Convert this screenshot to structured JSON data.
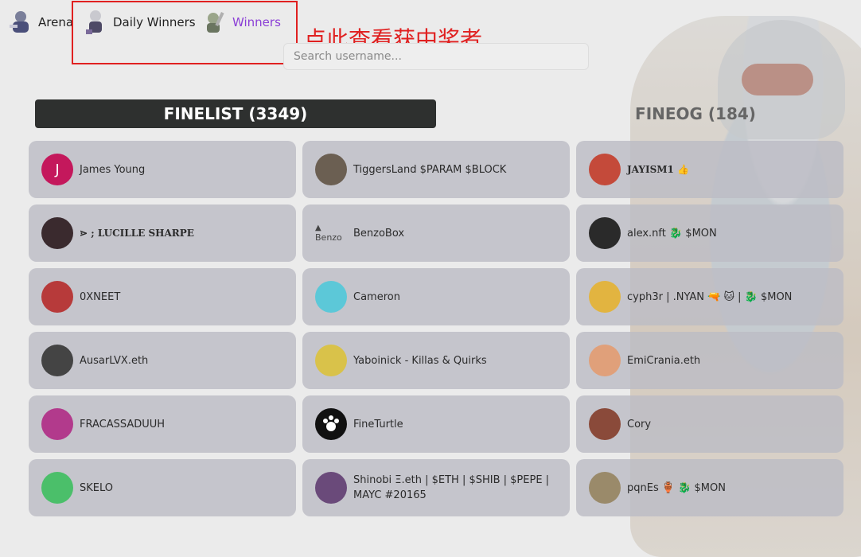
{
  "nav": {
    "arena": "Arena",
    "daily_winners": "Daily Winners",
    "winners": "Winners"
  },
  "annotation": "点此查看获中奖者",
  "search": {
    "placeholder": "Search username..."
  },
  "tabs": {
    "finelist": "FINELIST (3349)",
    "fineog": "FINEOG (184)"
  },
  "colors": {
    "active_tab": "#2e302f",
    "winners_link": "#8b3fd6",
    "annotation": "#e02020"
  },
  "finelist_col1": [
    {
      "name": "James Young",
      "avatar_letter": "J",
      "avatar_color": "#c4185c"
    },
    {
      "name": "⋗ ; LUCILLE SHARPE",
      "avatar_color": "#3a2a2e"
    },
    {
      "name": "0XNEET",
      "avatar_color": "#b73a3a"
    },
    {
      "name": "AusarLVX.eth",
      "avatar_color": "#444444"
    },
    {
      "name": "FRACASSADUUH",
      "avatar_color": "#b23a8c"
    },
    {
      "name": "SKELO",
      "avatar_color": "#4bbf6a"
    }
  ],
  "finelist_col2": [
    {
      "name": "TiggersLand $PARAM $BLOCK",
      "avatar_color": "#6b5f52"
    },
    {
      "name": "BenzoBox",
      "broken_alt": "Benzo"
    },
    {
      "name": "Cameron",
      "avatar_color": "#5cc8d8"
    },
    {
      "name": "Yaboinick - Killas & Quirks",
      "avatar_color": "#d9c24a"
    },
    {
      "name": "FineTurtle",
      "avatar_color": "#111111"
    },
    {
      "name": "Shinobi Ξ.eth | $ETH | $SHIB | $PEPE | MAYC #20165",
      "avatar_color": "#6a4a7a"
    }
  ],
  "fineog_col": [
    {
      "name": "JAYISM1 👍",
      "avatar_color": "#c44a3a"
    },
    {
      "name": "alex.nft 🐉 $MON",
      "avatar_color": "#2a2a2a"
    },
    {
      "name": "cyph3r | .NYAN 🔫 🐱 | 🐉 $MON",
      "avatar_color": "#e2b440"
    },
    {
      "name": "EmiCrania.eth",
      "avatar_color": "#e0a07a"
    },
    {
      "name": "Cory",
      "avatar_color": "#8a4a3a"
    },
    {
      "name": "pqnEs 🏺 🐉 $MON",
      "avatar_color": "#9a8a6a"
    }
  ]
}
